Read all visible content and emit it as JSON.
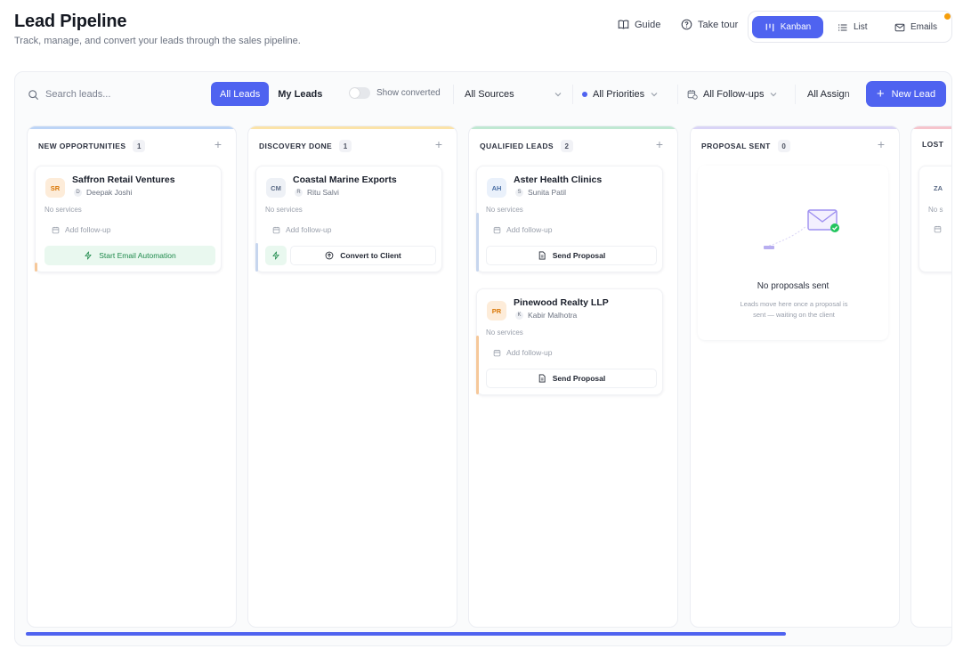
{
  "header": {
    "title": "Lead Pipeline",
    "subtitle": "Track, manage, and convert your leads through the sales pipeline.",
    "guide_label": "Guide",
    "tour_label": "Take tour",
    "views": {
      "kanban": "Kanban",
      "list": "List",
      "emails": "Emails"
    },
    "active_view": "Kanban"
  },
  "toolbar": {
    "search_placeholder": "Search leads...",
    "scope": {
      "all": "All Leads",
      "mine": "My Leads",
      "active": "All Leads"
    },
    "show_converted_label": "Show converted",
    "show_converted": false,
    "sources_value": "All Sources",
    "priorities_value": "All Priorities",
    "followups_value": "All Follow-ups",
    "assignees_value": "All Assign",
    "new_lead_label": "New Lead"
  },
  "columns": [
    {
      "title": "NEW OPPORTUNITIES",
      "count": "1",
      "color": "#bcd4f6",
      "cards": [
        {
          "initials": "SR",
          "name": "Saffron Retail Ventures",
          "owner_initial": "D",
          "owner": "Deepak Joshi",
          "services": "No services",
          "followup": "Add follow-up",
          "action": "Start Email Automation",
          "avatar_bg": "#fdecd9",
          "avatar_fg": "#d97706",
          "accent": "#f6c89a"
        }
      ]
    },
    {
      "title": "DISCOVERY DONE",
      "count": "1",
      "color": "#fbe3a8",
      "cards": [
        {
          "initials": "CM",
          "name": "Coastal Marine Exports",
          "owner_initial": "R",
          "owner": "Ritu Salvi",
          "services": "No services",
          "followup": "Add follow-up",
          "action": "Convert to Client",
          "avatar_bg": "#eef1f6",
          "avatar_fg": "#5b6b86",
          "accent": "#c7d6ee"
        }
      ]
    },
    {
      "title": "QUALIFIED LEADS",
      "count": "2",
      "color": "#bfe8d2",
      "cards": [
        {
          "initials": "AH",
          "name": "Aster Health Clinics",
          "owner_initial": "S",
          "owner": "Sunita Patil",
          "services": "No services",
          "followup": "Add follow-up",
          "action": "Send Proposal",
          "avatar_bg": "#eaf1fb",
          "avatar_fg": "#4a6fa5",
          "accent": "#c7d6ee"
        },
        {
          "initials": "PR",
          "name": "Pinewood Realty LLP",
          "owner_initial": "K",
          "owner": "Kabir Malhotra",
          "services": "No services",
          "followup": "Add follow-up",
          "action": "Send Proposal",
          "avatar_bg": "#fdecd9",
          "avatar_fg": "#d97706",
          "accent": "#f6c89a"
        }
      ]
    },
    {
      "title": "PROPOSAL SENT",
      "count": "0",
      "color": "#d9d4f6",
      "empty_title": "No proposals sent",
      "empty_desc": "Leads move here once a proposal is sent — waiting on the client"
    },
    {
      "title": "LOST",
      "color": "#f6c4cc",
      "partial_initials": "ZA",
      "partial_services": "No s"
    }
  ],
  "icons": {
    "search": "search-icon",
    "guide": "book-icon",
    "tour": "help-circle-icon",
    "kanban": "kanban-icon",
    "list": "list-icon",
    "emails": "mail-icon",
    "followup": "calendar-icon",
    "bolt": "bolt-icon",
    "convert": "arrow-up-circle-icon",
    "proposal": "document-icon",
    "chevron": "chevron-down-icon"
  }
}
